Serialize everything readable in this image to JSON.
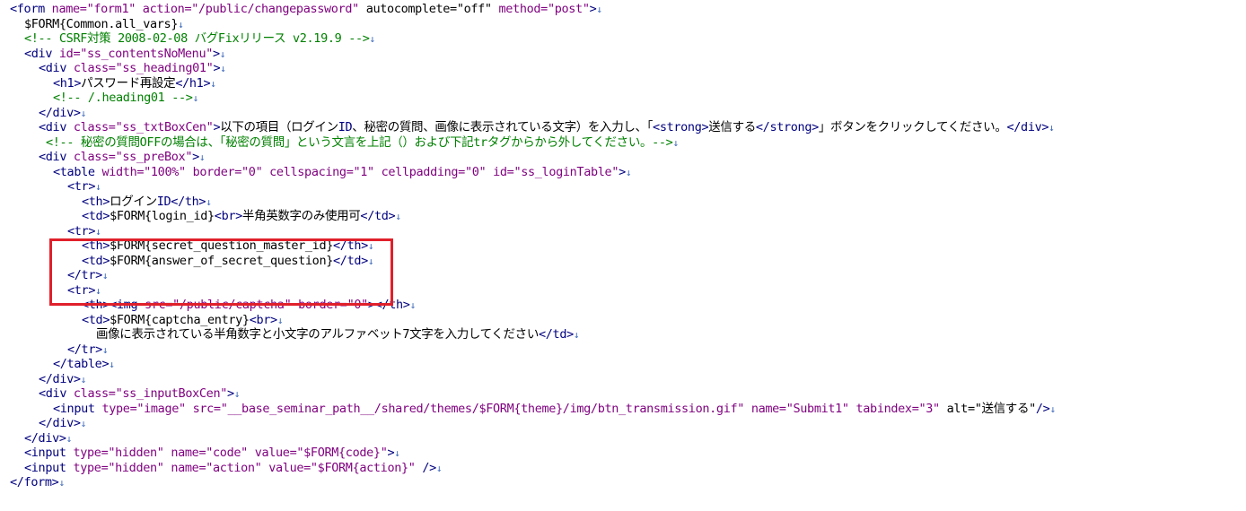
{
  "editor": {
    "eol_marker": "↓",
    "highlight_color": "#e0202b",
    "colors": {
      "tag": "#00007f",
      "attr": "#7f007f",
      "value": "#7f007f",
      "text": "#000000",
      "comment": "#008000",
      "eol": "#3a66b8"
    },
    "lines": [
      {
        "indent": 0,
        "t": [
          [
            "tag",
            "<form "
          ],
          [
            "attr",
            "name="
          ],
          [
            "val",
            "\"form1\" "
          ],
          [
            "attr",
            "action="
          ],
          [
            "val",
            "\"/public/changepassword\" "
          ],
          [
            "text",
            "autocomplete=\"off\" "
          ],
          [
            "attr",
            "method="
          ],
          [
            "val",
            "\"post\""
          ],
          [
            "tag",
            ">"
          ]
        ]
      },
      {
        "indent": 1,
        "t": [
          [
            "text",
            "$FORM{Common.all_vars}"
          ]
        ]
      },
      {
        "indent": 1,
        "t": [
          [
            "comment",
            "<!-- CSRF対策 2008-02-08 バグFixリリース v2.19.9 -->"
          ]
        ]
      },
      {
        "indent": 1,
        "t": [
          [
            "tag",
            "<div "
          ],
          [
            "attr",
            "id="
          ],
          [
            "val",
            "\"ss_contentsNoMenu\""
          ],
          [
            "tag",
            ">"
          ]
        ]
      },
      {
        "indent": 2,
        "t": [
          [
            "tag",
            "<div "
          ],
          [
            "attr",
            "class="
          ],
          [
            "val",
            "\"ss_heading01\""
          ],
          [
            "tag",
            ">"
          ]
        ]
      },
      {
        "indent": 3,
        "t": [
          [
            "tag",
            "<h1>"
          ],
          [
            "text",
            "パスワード再設定"
          ],
          [
            "tag",
            "</h1>"
          ]
        ]
      },
      {
        "indent": 3,
        "t": [
          [
            "comment",
            "<!-- /.heading01 -->"
          ]
        ]
      },
      {
        "indent": 2,
        "t": [
          [
            "tag",
            "</div>"
          ]
        ]
      },
      {
        "indent": 2,
        "t": [
          [
            "tag",
            "<div "
          ],
          [
            "attr",
            "class="
          ],
          [
            "val",
            "\"ss_txtBoxCen\""
          ],
          [
            "tag",
            ">"
          ],
          [
            "text",
            "以下の項目（ログイン"
          ],
          [
            "tag",
            "ID"
          ],
          [
            "text",
            "、秘密の質問、画像に表示されている文字）を入力し、「"
          ],
          [
            "tag",
            "<strong>"
          ],
          [
            "text",
            "送信する"
          ],
          [
            "tag",
            "</strong>"
          ],
          [
            "text",
            "」ボタンをクリックしてください。"
          ],
          [
            "tag",
            "</div>"
          ]
        ]
      },
      {
        "indent": 2.5,
        "t": [
          [
            "comment",
            "<!-- 秘密の質問OFFの場合は、「秘密の質問」という文言を上記（）および下記trタグからから外してください。-->"
          ]
        ]
      },
      {
        "indent": 2,
        "t": [
          [
            "tag",
            "<div "
          ],
          [
            "attr",
            "class="
          ],
          [
            "val",
            "\"ss_preBox\""
          ],
          [
            "tag",
            ">"
          ]
        ]
      },
      {
        "indent": 3,
        "t": [
          [
            "tag",
            "<table "
          ],
          [
            "attr",
            "width="
          ],
          [
            "val",
            "\"100%\" "
          ],
          [
            "attr",
            "border="
          ],
          [
            "val",
            "\"0\" "
          ],
          [
            "attr",
            "cellspacing="
          ],
          [
            "val",
            "\"1\" "
          ],
          [
            "attr",
            "cellpadding="
          ],
          [
            "val",
            "\"0\" "
          ],
          [
            "attr",
            "id="
          ],
          [
            "val",
            "\"ss_loginTable\""
          ],
          [
            "tag",
            ">"
          ]
        ]
      },
      {
        "indent": 4,
        "t": [
          [
            "tag",
            "<tr>"
          ]
        ]
      },
      {
        "indent": 5,
        "t": [
          [
            "tag",
            "<th>"
          ],
          [
            "text",
            "ログイン"
          ],
          [
            "tag",
            "ID</th>"
          ]
        ]
      },
      {
        "indent": 5,
        "t": [
          [
            "tag",
            "<td>"
          ],
          [
            "text",
            "$FORM{login_id}"
          ],
          [
            "tag",
            "<br>"
          ],
          [
            "text",
            "半角英数字のみ使用可"
          ],
          [
            "tag",
            "</td>"
          ]
        ]
      },
      {
        "indent": 4,
        "t": [
          [
            "tag",
            "<tr>"
          ]
        ]
      },
      {
        "indent": 5,
        "t": [
          [
            "tag",
            "<th>"
          ],
          [
            "text",
            "$FORM{secret_question_master_id}"
          ],
          [
            "tag",
            "</th>"
          ]
        ]
      },
      {
        "indent": 5,
        "t": [
          [
            "tag",
            "<td>"
          ],
          [
            "text",
            "$FORM{answer_of_secret_question}"
          ],
          [
            "tag",
            "</td>"
          ]
        ]
      },
      {
        "indent": 4,
        "t": [
          [
            "tag",
            "</tr>"
          ]
        ]
      },
      {
        "indent": 4,
        "t": [
          [
            "tag",
            "<tr>"
          ]
        ]
      },
      {
        "indent": 5,
        "t": [
          [
            "tag",
            "<th><img "
          ],
          [
            "attr",
            "src="
          ],
          [
            "val",
            "\"/public/captcha\" "
          ],
          [
            "attr",
            "border="
          ],
          [
            "val",
            "\"0\""
          ],
          [
            "tag",
            "></th>"
          ]
        ]
      },
      {
        "indent": 5,
        "t": [
          [
            "tag",
            "<td>"
          ],
          [
            "text",
            "$FORM{captcha_entry}"
          ],
          [
            "tag",
            "<br>"
          ]
        ]
      },
      {
        "indent": 6,
        "t": [
          [
            "text",
            "画像に表示されている半角数字と小文字のアルファベット7文字を入力してください"
          ],
          [
            "tag",
            "</td>"
          ]
        ]
      },
      {
        "indent": 4,
        "t": [
          [
            "tag",
            "</tr>"
          ]
        ]
      },
      {
        "indent": 3,
        "t": [
          [
            "tag",
            "</table>"
          ]
        ]
      },
      {
        "indent": 2,
        "t": [
          [
            "tag",
            "</div>"
          ]
        ]
      },
      {
        "indent": 2,
        "t": [
          [
            "tag",
            "<div "
          ],
          [
            "attr",
            "class="
          ],
          [
            "val",
            "\"ss_inputBoxCen\""
          ],
          [
            "tag",
            ">"
          ]
        ]
      },
      {
        "indent": 3,
        "t": [
          [
            "tag",
            "<input "
          ],
          [
            "attr",
            "type="
          ],
          [
            "val",
            "\"image\" "
          ],
          [
            "attr",
            "src="
          ],
          [
            "val",
            "\"__base_seminar_path__/shared/themes/$FORM{theme}/img/btn_transmission.gif\" "
          ],
          [
            "attr",
            "name="
          ],
          [
            "val",
            "\"Submit1\" "
          ],
          [
            "attr",
            "tabindex="
          ],
          [
            "val",
            "\"3\" "
          ],
          [
            "text",
            "alt=\"送信する\""
          ],
          [
            "tag",
            "/>"
          ]
        ]
      },
      {
        "indent": 2,
        "t": [
          [
            "tag",
            "</div>"
          ]
        ]
      },
      {
        "indent": 1,
        "t": [
          [
            "tag",
            "</div>"
          ]
        ]
      },
      {
        "indent": 1,
        "t": [
          [
            "tag",
            "<input "
          ],
          [
            "attr",
            "type="
          ],
          [
            "val",
            "\"hidden\" "
          ],
          [
            "attr",
            "name="
          ],
          [
            "val",
            "\"code\" "
          ],
          [
            "attr",
            "value="
          ],
          [
            "val",
            "\"$FORM{code}\""
          ],
          [
            "tag",
            ">"
          ]
        ]
      },
      {
        "indent": 1,
        "t": [
          [
            "tag",
            "<input "
          ],
          [
            "attr",
            "type="
          ],
          [
            "val",
            "\"hidden\" "
          ],
          [
            "attr",
            "name="
          ],
          [
            "val",
            "\"action\" "
          ],
          [
            "attr",
            "value="
          ],
          [
            "val",
            "\"$FORM{action}\" "
          ],
          [
            "tag",
            "/>"
          ]
        ]
      },
      {
        "indent": 0,
        "t": [
          [
            "tag",
            "</form>"
          ]
        ]
      }
    ]
  }
}
